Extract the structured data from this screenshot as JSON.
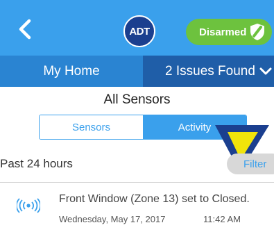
{
  "header": {
    "back_icon": "chevron-left-icon",
    "logo_text": "ADT",
    "status": {
      "label": "Disarmed",
      "icon": "shield-icon",
      "color": "#6dc23e"
    },
    "background_color": "#3aa0ec"
  },
  "nav": {
    "home_label": "My Home",
    "issues_label": "2 Issues Found",
    "issues_icon": "chevron-down-icon"
  },
  "page_title": "All Sensors",
  "segmented": {
    "tabs": [
      {
        "label": "Sensors",
        "active": false
      },
      {
        "label": "Activity",
        "active": true
      }
    ]
  },
  "pointer_icon": "arrow-pointer-icon",
  "filter_bar": {
    "range_label": "Past 24 hours",
    "filter_label": "Filter"
  },
  "events": [
    {
      "icon": "sensor-signal-icon",
      "title": "Front Window (Zone 13) set to Closed.",
      "date": "Wednesday, May 17, 2017",
      "time": "11:42 AM"
    }
  ]
}
